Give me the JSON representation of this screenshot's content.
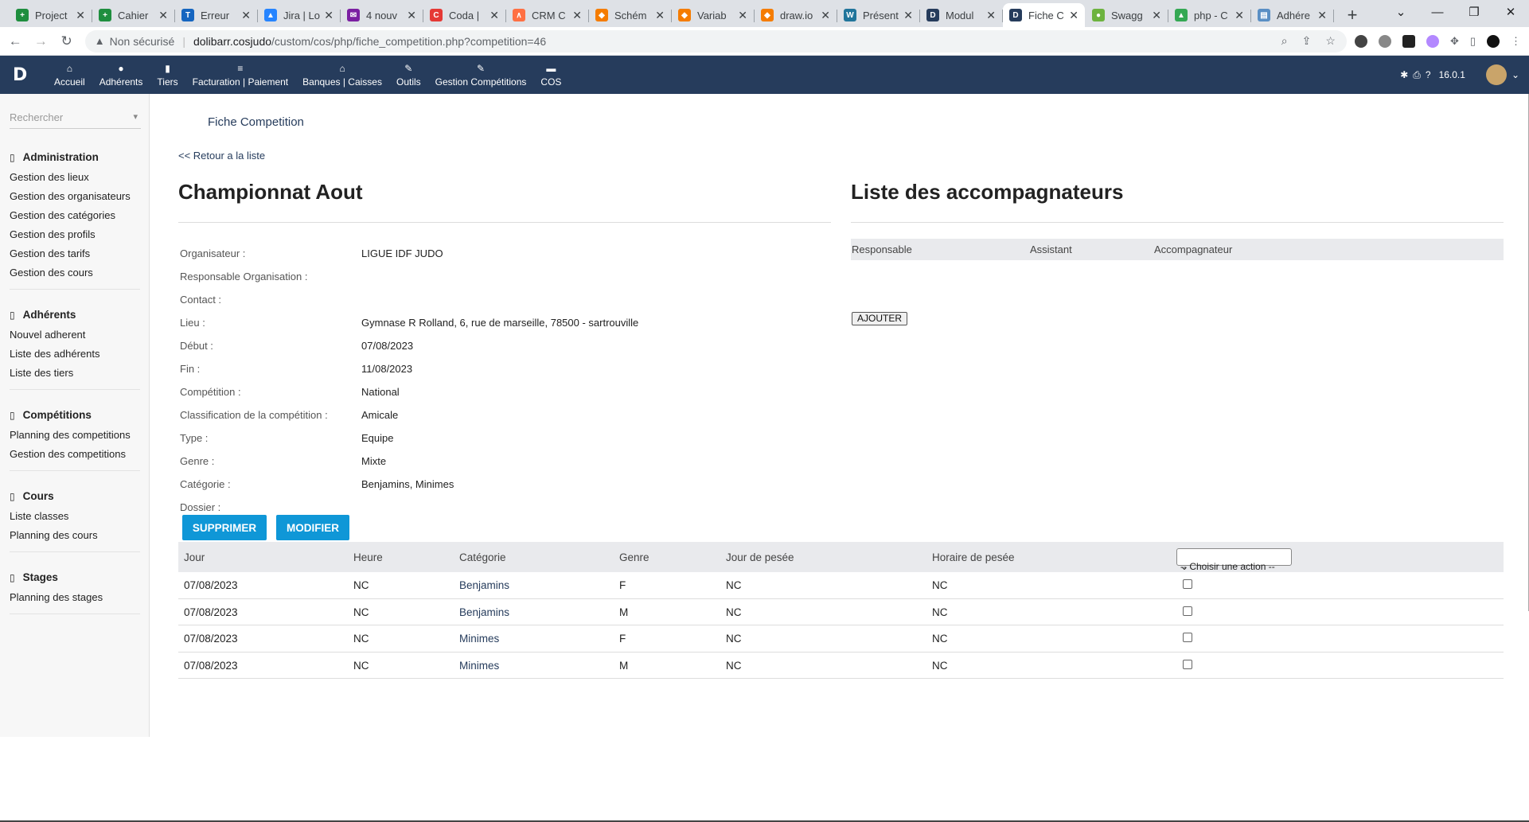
{
  "browser": {
    "tabs": [
      {
        "title": "Project",
        "color": "#1e8e3e",
        "glyph": "+"
      },
      {
        "title": "Cahier",
        "color": "#1e8e3e",
        "glyph": "+"
      },
      {
        "title": "Erreur",
        "color": "#1565c0",
        "glyph": "T"
      },
      {
        "title": "Jira | Lo",
        "color": "#2684ff",
        "glyph": "▲"
      },
      {
        "title": "4 nouv",
        "color": "#7b1fa2",
        "glyph": "✉"
      },
      {
        "title": "Coda |",
        "color": "#e53935",
        "glyph": "C"
      },
      {
        "title": "CRM C",
        "color": "#ff7043",
        "glyph": "∧"
      },
      {
        "title": "Schém",
        "color": "#f57c00",
        "glyph": "◆"
      },
      {
        "title": "Variab",
        "color": "#f57c00",
        "glyph": "◆"
      },
      {
        "title": "draw.io",
        "color": "#f57c00",
        "glyph": "◆"
      },
      {
        "title": "Présent",
        "color": "#21759b",
        "glyph": "W"
      },
      {
        "title": "Modul",
        "color": "#263c5c",
        "glyph": "D"
      },
      {
        "title": "Fiche C",
        "color": "#263c5c",
        "glyph": "D"
      },
      {
        "title": "Swagg",
        "color": "#6db33f",
        "glyph": "●"
      },
      {
        "title": "php - C",
        "color": "#34a853",
        "glyph": "▲"
      },
      {
        "title": "Adhére",
        "color": "#5a8fc4",
        "glyph": "▤"
      }
    ],
    "active_tab": 12,
    "new_tab_label": "+",
    "security_label": "Non sécurisé",
    "url_host": "dolibarr.cosjudo",
    "url_path": "/custom/cos/php/fiche_competition.php?competition=46"
  },
  "topmenu": {
    "items": [
      {
        "label": "Accueil",
        "icon": "home-icon",
        "glyph": "⌂"
      },
      {
        "label": "Adhérents",
        "icon": "user-icon",
        "glyph": "●"
      },
      {
        "label": "Tiers",
        "icon": "building-icon",
        "glyph": "▮"
      },
      {
        "label": "Facturation | Paiement",
        "icon": "money-icon",
        "glyph": "≡"
      },
      {
        "label": "Banques | Caisses",
        "icon": "bank-icon",
        "glyph": "⌂"
      },
      {
        "label": "Outils",
        "icon": "wrench-icon",
        "glyph": "✎"
      },
      {
        "label": "Gestion Compétitions",
        "icon": "edit-icon",
        "glyph": "✎"
      },
      {
        "label": "COS",
        "icon": "doc-icon",
        "glyph": "▬"
      }
    ],
    "version": "16.0.1",
    "brand_color": "#263c5c"
  },
  "sidebar": {
    "search_placeholder": "Rechercher",
    "sections": [
      {
        "title": "Administration",
        "items": [
          "Gestion des lieux",
          "Gestion des organisateurs",
          "Gestion des catégories",
          "Gestion des profils",
          "Gestion des tarifs",
          "Gestion des cours"
        ]
      },
      {
        "title": "Adhérents",
        "items": [
          "Nouvel adherent",
          "Liste des adhérents",
          "Liste des tiers"
        ]
      },
      {
        "title": "Compétitions",
        "items": [
          "Planning des competitions",
          "Gestion des competitions"
        ]
      },
      {
        "title": "Cours",
        "items": [
          "Liste classes",
          "Planning des cours"
        ]
      },
      {
        "title": "Stages",
        "items": [
          "Planning des stages"
        ]
      }
    ]
  },
  "main": {
    "page_tab": "Fiche Competition",
    "back_link": "<< Retour a la liste",
    "title": "Championnat Aout",
    "fields": [
      {
        "label": "Organisateur :",
        "value": "LIGUE IDF JUDO"
      },
      {
        "label": "Responsable Organisation :",
        "value": ""
      },
      {
        "label": "Contact :",
        "value": ""
      },
      {
        "label": "Lieu :",
        "value": "Gymnase R Rolland, 6, rue de marseille, 78500 - sartrouville"
      },
      {
        "label": "Début :",
        "value": "07/08/2023"
      },
      {
        "label": "Fin :",
        "value": "11/08/2023"
      },
      {
        "label": "Compétition :",
        "value": "National"
      },
      {
        "label": "Classification de la compétition :",
        "value": "Amicale"
      },
      {
        "label": "Type :",
        "value": "Equipe"
      },
      {
        "label": "Genre :",
        "value": "Mixte"
      },
      {
        "label": "Catégorie :",
        "value": "Benjamins, Minimes"
      },
      {
        "label": "Dossier :",
        "value": ""
      }
    ],
    "delete_label": "SUPPRIMER",
    "modify_label": "MODIFIER",
    "accent_color": "#0f97d7"
  },
  "accompagnateurs": {
    "title": "Liste des accompagnateurs",
    "columns": [
      "Responsable",
      "Assistant",
      "Accompagnateur"
    ],
    "add_label": "AJOUTER"
  },
  "sessions": {
    "columns": [
      "Jour",
      "Heure",
      "Catégorie",
      "Genre",
      "Jour de pesée",
      "Horaire de pesée"
    ],
    "action_select": "-- Choisir une action --",
    "rows": [
      {
        "jour": "07/08/2023",
        "heure": "NC",
        "categorie": "Benjamins",
        "genre": "F",
        "jour_pesee": "NC",
        "horaire_pesee": "NC"
      },
      {
        "jour": "07/08/2023",
        "heure": "NC",
        "categorie": "Benjamins",
        "genre": "M",
        "jour_pesee": "NC",
        "horaire_pesee": "NC"
      },
      {
        "jour": "07/08/2023",
        "heure": "NC",
        "categorie": "Minimes",
        "genre": "F",
        "jour_pesee": "NC",
        "horaire_pesee": "NC"
      },
      {
        "jour": "07/08/2023",
        "heure": "NC",
        "categorie": "Minimes",
        "genre": "M",
        "jour_pesee": "NC",
        "horaire_pesee": "NC"
      }
    ]
  }
}
